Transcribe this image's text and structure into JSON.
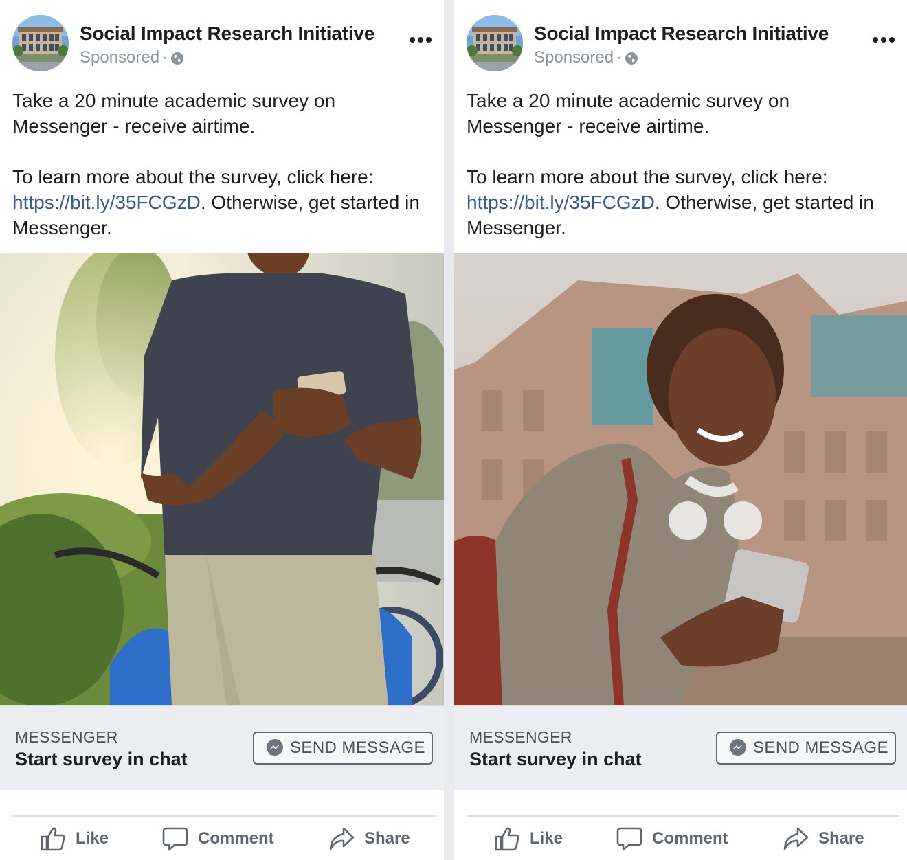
{
  "posts": [
    {
      "page_name": "Social Impact Research Initiative",
      "sponsored_label": "Sponsored",
      "meta_separator": "·",
      "body_line_1": "Take a 20 minute academic survey on",
      "body_line_2": "Messenger - receive airtime.",
      "body_line_3": "To learn more about the survey, click here:",
      "link_text": "https://bit.ly/35FCGzD",
      "body_line_4_after_link": ". Otherwise, get started in",
      "body_line_5": "Messenger.",
      "image_subject": "man-with-phone-and-bicycle",
      "cta_source": "MESSENGER",
      "cta_headline": "Start survey in chat",
      "cta_button_label": "SEND MESSAGE",
      "actions": {
        "like": "Like",
        "comment": "Comment",
        "share": "Share"
      }
    },
    {
      "page_name": "Social Impact Research Initiative",
      "sponsored_label": "Sponsored",
      "meta_separator": "·",
      "body_line_1": "Take a 20 minute academic survey on",
      "body_line_2": "Messenger - receive airtime.",
      "body_line_3": "To learn more about the survey, click here:",
      "link_text": "https://bit.ly/35FCGzD",
      "body_line_4_after_link": ". Otherwise, get started in",
      "body_line_5": "Messenger.",
      "image_subject": "woman-with-phone-and-headphones",
      "cta_source": "MESSENGER",
      "cta_headline": "Start survey in chat",
      "cta_button_label": "SEND MESSAGE",
      "actions": {
        "like": "Like",
        "comment": "Comment",
        "share": "Share"
      }
    }
  ],
  "colors": {
    "link": "#385898",
    "text_primary": "#1c1e21",
    "text_secondary": "#8d949e",
    "cta_background": "#ebedf0",
    "messenger_blue": "#0084ff"
  },
  "icons": [
    "avatar-building-icon",
    "globe-icon",
    "more-options-icon",
    "messenger-icon",
    "like-icon",
    "comment-icon",
    "share-icon"
  ]
}
